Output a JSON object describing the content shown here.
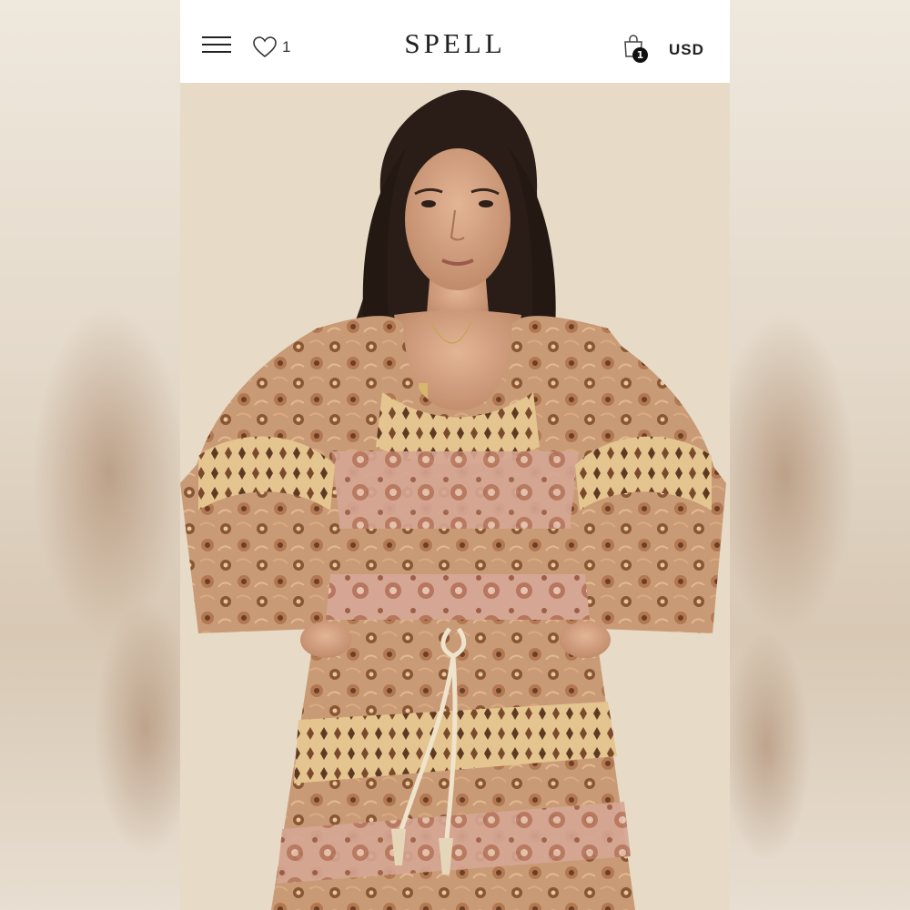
{
  "header": {
    "logo": "SPELL",
    "wishlist_count": "1",
    "cart_count": "1",
    "currency": "USD",
    "icons": {
      "menu": "hamburger-menu-icon",
      "wishlist": "heart-outline-icon",
      "cart": "shopping-bag-icon"
    }
  },
  "product_image": {
    "colors": {
      "background": "#e8dcc8",
      "fabric_base": "#c99a76",
      "fabric_dark": "#7a4a2c",
      "fabric_light": "#e8c99b",
      "hair": "#2a1d17"
    }
  }
}
